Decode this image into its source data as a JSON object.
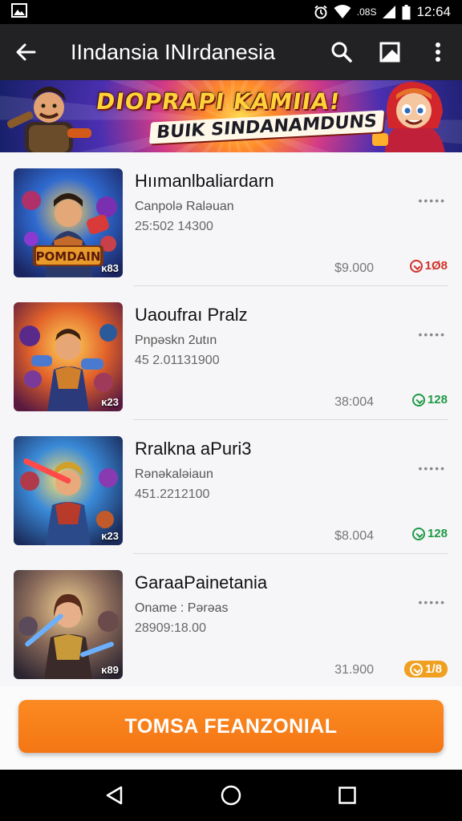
{
  "status_bar": {
    "network": ".08S",
    "time": "12:64"
  },
  "app_bar": {
    "title": "IIndansia INIrdanesia"
  },
  "banner": {
    "line1": "DIOPRAPI KAMIIA!",
    "line2": "BUIK SINDANAMDUNS"
  },
  "items": [
    {
      "name": "Hıımanlbaliardarn",
      "subtitle": "Canpolə Raləuan",
      "number": "25:502 14300",
      "price": "$9.000",
      "score": "1Ø8",
      "score_color": "#d0332a",
      "badge": "κ83",
      "thumb_caption": "POMDAIN"
    },
    {
      "name": "Uaoufraı Pralz",
      "subtitle": "Pnpəskn 2utın",
      "number": "45 2.01131900",
      "price": "38:004",
      "score": "128",
      "score_color": "#1f9a47",
      "badge": "κ23"
    },
    {
      "name": "Rralkna aPuri3",
      "subtitle": "Rənəkaləiaun",
      "number": "451.2212100",
      "price": "$8.004",
      "score": "128",
      "score_color": "#1f9a47",
      "badge": "κ23"
    },
    {
      "name": "GaraaPainetania",
      "subtitle": "Oname  : Pərəas",
      "number": "28909:18.00",
      "price": "31.900",
      "score": "1/8",
      "score_color": "#f0a020",
      "badge": "κ89"
    }
  ],
  "more_label": "•••••",
  "cta": {
    "label": "TOMSA FEANZONIAL"
  },
  "colors": {
    "accent": "#f47614",
    "app_bar": "#222225",
    "status_bar": "#000000"
  }
}
